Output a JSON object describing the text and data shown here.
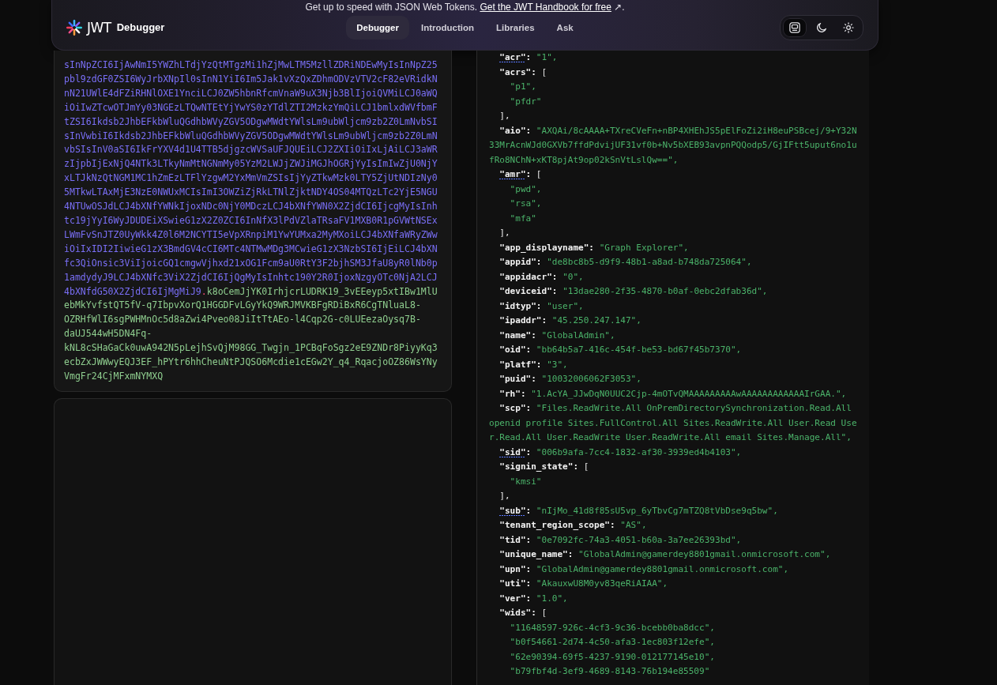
{
  "banner": {
    "text": "Get up to speed with JSON Web Tokens.",
    "link": "Get the JWT Handbook for free",
    "suffix": "↗."
  },
  "nav": {
    "logo_text": "JWT",
    "title": "Debugger",
    "tabs": [
      {
        "label": "Debugger",
        "selected": true
      },
      {
        "label": "Introduction",
        "selected": false
      },
      {
        "label": "Libraries",
        "selected": false
      },
      {
        "label": "Ask",
        "selected": false
      }
    ],
    "theme_options": [
      {
        "kind": "system",
        "selected": true
      },
      {
        "kind": "dark",
        "selected": false
      },
      {
        "kind": "light",
        "selected": false
      }
    ]
  },
  "encoded_token": {
    "segments": [
      {
        "kind": "payload",
        "text": "sInNpZCI6IjAwNmI5YWZhLTdjYzQtMTgzMi1hZjMwLTM5MzllZDRiNDEwMyIsInNpZ25pbl9zdGF0ZSI6WyJrbXNpIl0sInN1YiI6Im5Jak1vXzQxZDhmODVzVTV2cF82eVRidkNnN21UWlE4dFZiRHNlOXE1YnciLCJ0ZW5hbnRfcmVnaW9uX3Njb3BlIjoiQVMiLCJ0aWQiOiIwZTcwOTJmYy03NGEzLTQwNTEtYjYwYS0zYTdlZTI2MzkzYmQiLCJ1bmlxdWVfbmFtZSI6Ikdsb2JhbEFkbWluQGdhbWVyZGV5ODgwMWdtYWlsLm9ubWljcm9zb2Z0LmNvbSIsInVwbiI6Ikdsb2JhbEFkbWluQGdhbWVyZGV5ODgwMWdtYWlsLm9ubWljcm9zb2Z0LmNvbSIsInV0aSI6IkFrYXV4d1U4TTB5djgzcWVSaUFJQUEiLCJ2ZXIiOiIxLjAiLCJ3aWRzIjpbIjExNjQ4NTk3LTkyNmMtNGNmMy05YzM2LWJjZWJiMGJhOGRjYyIsImIwZjU0NjYxLTJkNzQtNGM1MC1hZmEzLTFlYzgwM2YxMmVmZSIsIjYyZTkwMzk0LTY5ZjUtNDIzNy05MTkwLTAxMjE3NzE0NWUxMCIsImI3OWZiZjRkLTNlZjktNDY4OS04MTQzLTc2YjE5NGU4NTUwOSJdLCJ4bXNfYWNkIjoxNDc0NjY0MDczLCJ4bXNfYWN0X2ZjdCI6IjcgMyIsInhtc19jYyI6WyJDUDEiXSwieG1zX2Z0ZCI6InNfX3lPdVZlaTRsaFV1MXB0R1pGVWtNSExLWmFvSnJTZ0UyWkk4Z0l6M2NCYTI5eVpXRnpiM1YwYUMxa2MyMXoiLCJ4bXNfaWRyZWwiOiIxIDI2IiwieG1zX3BmdGV4cCI6MTc4NTMwMDg3MCwieG1zX3NzbSI6IjEiLCJ4bXNfc3QiOnsic3ViIjoicGQ1cmgwVjhxd21xOG1Fcm9aU0RtY3F2bjhSM3JfaU8yR0lNb0p1amdydyJ9LCJ4bXNfc3ViX2ZjdCI6IjQgMyIsInhtc190Y2R0IjoxNzgyOTc0NjA2LCJ4bXNfdG50X2ZjdCI6IjMgMiJ9"
      },
      {
        "kind": "separator",
        "text": "."
      },
      {
        "kind": "signature",
        "text": "k8oCemJjYK0IrhjcrLUDRK19_3vEEeyp5xtIBw1MlUebMkYvfstQT5fV-q7IbpvXorQ1HGGDFvLGyYkQ9WRJMVKBFgRDiBxR6CgTNluaL8-OZRHfWlI6sgPWHMnOc5d8aZwi4Pveo08JiItTtAEo-l4Cqp2G-c0LUEezaOysq7B-daUJ544wH5DN4Fq-kNL8cSHaGaCk0uwA942N5pLejhSvQjM98GG_Twgjn_1PCBqFoSgz2eE9ZNDr8PiyyKq3ecbZxJWWwyEQJ3EF_hPYtr6hhCheuNtPJQSO6Mcdie1cEGw2Y_q4_RqacjoOZ86WsYNyVmgFr24CjMFxmNYMXQ"
      }
    ]
  },
  "decoded_payload": {
    "lines": [
      {
        "kind": "pair",
        "key": "\"acr\":",
        "value": "\"1\",",
        "documented": true
      },
      {
        "kind": "open",
        "key": "\"acrs\":",
        "value": "[",
        "documented": false
      },
      {
        "kind": "item",
        "value": "\"p1\","
      },
      {
        "kind": "item",
        "value": "\"pfdr\""
      },
      {
        "kind": "close",
        "value": "],"
      },
      {
        "kind": "pair",
        "key": "\"aio\":",
        "value": "\"AXQAi/8cAAAA+TXreCVeFn+nBP4XHEhJS5pElFoZi2iH8euPSBcej/9+Y32N33MrAcnWJd0GXVb7ffdPdvijUF31vf0b+Nv5bXEB93avpnPQQodp5/GjIFtt5uput6no1ufRo8NChN+xKT8pjAt9op02kSnVtLslQw==\",",
        "documented": false
      },
      {
        "kind": "open",
        "key": "\"amr\":",
        "value": "[",
        "documented": true
      },
      {
        "kind": "item",
        "value": "\"pwd\","
      },
      {
        "kind": "item",
        "value": "\"rsa\","
      },
      {
        "kind": "item",
        "value": "\"mfa\""
      },
      {
        "kind": "close",
        "value": "],"
      },
      {
        "kind": "pair",
        "key": "\"app_displayname\":",
        "value": "\"Graph Explorer\",",
        "documented": false
      },
      {
        "kind": "pair",
        "key": "\"appid\":",
        "value": "\"de8bc8b5-d9f9-48b1-a8ad-b748da725064\",",
        "documented": false
      },
      {
        "kind": "pair",
        "key": "\"appidacr\":",
        "value": "\"0\",",
        "documented": false
      },
      {
        "kind": "pair",
        "key": "\"deviceid\":",
        "value": "\"13dae280-2f35-4870-b0af-0ebc2dfab36d\",",
        "documented": false
      },
      {
        "kind": "pair",
        "key": "\"idtyp\":",
        "value": "\"user\",",
        "documented": false
      },
      {
        "kind": "pair",
        "key": "\"ipaddr\":",
        "value": "\"45.250.247.147\",",
        "documented": false
      },
      {
        "kind": "pair",
        "key": "\"name\":",
        "value": "\"GlobalAdmin\",",
        "documented": false
      },
      {
        "kind": "pair",
        "key": "\"oid\":",
        "value": "\"bb64b5a7-416c-454f-be53-bd67f45b7370\",",
        "documented": false
      },
      {
        "kind": "pair",
        "key": "\"platf\":",
        "value": "\"3\",",
        "documented": false
      },
      {
        "kind": "pair",
        "key": "\"puid\":",
        "value": "\"10032006062F3053\",",
        "documented": false
      },
      {
        "kind": "pair",
        "key": "\"rh\":",
        "value": "\"1.AcYA_JJwDqN0UUC2Cjp-4mOTvQMAAAAAAAAAwAAAAAAAAAAAAIrGAA.\",",
        "documented": false
      },
      {
        "kind": "pair",
        "key": "\"scp\":",
        "value": "\"Files.ReadWrite.All OnPremDirectorySynchronization.Read.All openid profile Sites.FullControl.All Sites.ReadWrite.All User.Read User.Read.All User.ReadWrite User.ReadWrite.All email Sites.Manage.All\",",
        "documented": false
      },
      {
        "kind": "pair",
        "key": "\"sid\":",
        "value": "\"006b9afa-7cc4-1832-af30-3939ed4b4103\",",
        "documented": true
      },
      {
        "kind": "open",
        "key": "\"signin_state\":",
        "value": "[",
        "documented": false
      },
      {
        "kind": "item",
        "value": "\"kmsi\""
      },
      {
        "kind": "close",
        "value": "],"
      },
      {
        "kind": "pair",
        "key": "\"sub\":",
        "value": "\"nIjMo_41d8f85sU5vp_6yTbvCg7mTZQ8tVbDse9q5bw\",",
        "documented": true
      },
      {
        "kind": "pair",
        "key": "\"tenant_region_scope\":",
        "value": "\"AS\",",
        "documented": false
      },
      {
        "kind": "pair",
        "key": "\"tid\":",
        "value": "\"0e7092fc-74a3-4051-b60a-3a7ee26393bd\",",
        "documented": false
      },
      {
        "kind": "pair",
        "key": "\"unique_name\":",
        "value": "\"GlobalAdmin@gamerdey8801gmail.onmicrosoft.com\",",
        "documented": false
      },
      {
        "kind": "pair",
        "key": "\"upn\":",
        "value": "\"GlobalAdmin@gamerdey8801gmail.onmicrosoft.com\",",
        "documented": false
      },
      {
        "kind": "pair",
        "key": "\"uti\":",
        "value": "\"AkauxwU8M0yv83qeRiAIAA\",",
        "documented": false
      },
      {
        "kind": "pair",
        "key": "\"ver\":",
        "value": "\"1.0\",",
        "documented": false
      },
      {
        "kind": "open",
        "key": "\"wids\":",
        "value": "[",
        "documented": false
      },
      {
        "kind": "item",
        "value": "\"11648597-926c-4cf3-9c36-bcebb0ba8dcc\","
      },
      {
        "kind": "item",
        "value": "\"b0f54661-2d74-4c50-afa3-1ec803f12efe\","
      },
      {
        "kind": "item",
        "value": "\"62e90394-69f5-4237-9190-012177145e10\","
      },
      {
        "kind": "item",
        "value": "\"b79fbf4d-3ef9-4689-8143-76b194e85509\""
      }
    ]
  }
}
